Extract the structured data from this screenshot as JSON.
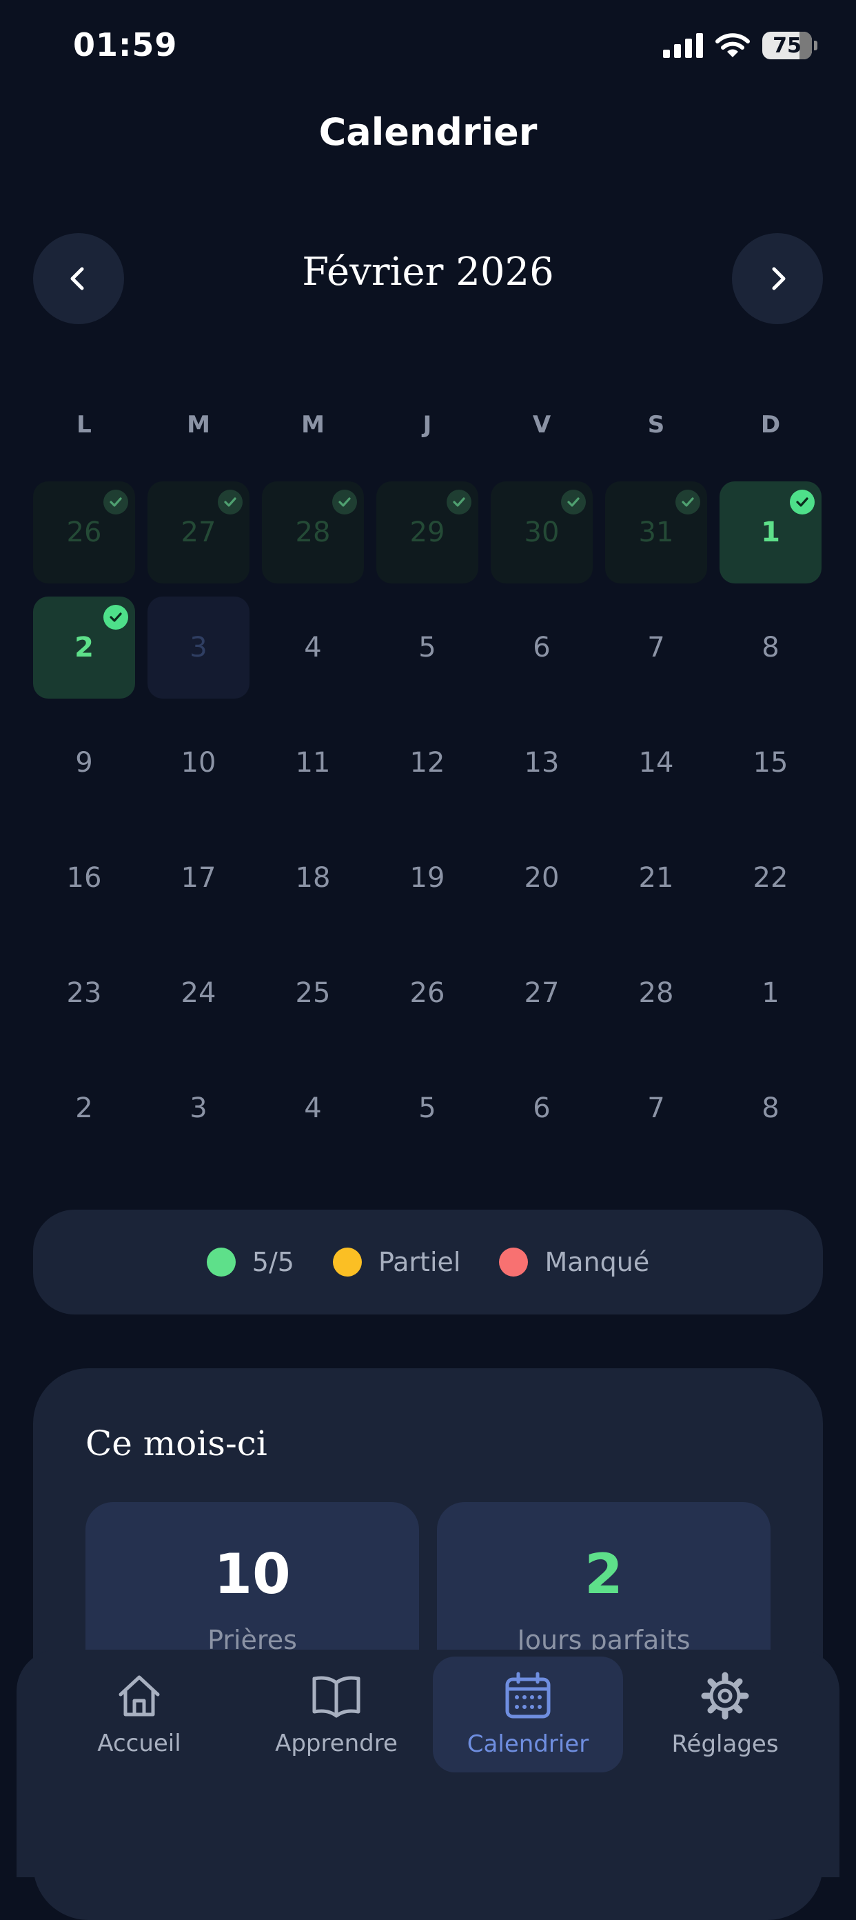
{
  "status_bar": {
    "time": "01:59",
    "battery": "75"
  },
  "header": {
    "title": "Calendrier"
  },
  "month_nav": {
    "title": "Février 2026",
    "prev_icon": "chevron-left-icon",
    "next_icon": "chevron-right-icon"
  },
  "weekdays": [
    "L",
    "M",
    "M",
    "J",
    "V",
    "S",
    "D"
  ],
  "weeks": [
    [
      {
        "label": "26",
        "state": "past",
        "check": true
      },
      {
        "label": "27",
        "state": "past",
        "check": true
      },
      {
        "label": "28",
        "state": "past",
        "check": true
      },
      {
        "label": "29",
        "state": "past",
        "check": true
      },
      {
        "label": "30",
        "state": "past",
        "check": true
      },
      {
        "label": "31",
        "state": "past",
        "check": true
      },
      {
        "label": "1",
        "state": "done",
        "check": true
      }
    ],
    [
      {
        "label": "2",
        "state": "done",
        "check": true
      },
      {
        "label": "3",
        "state": "today",
        "check": false
      },
      {
        "label": "4",
        "state": "future",
        "check": false
      },
      {
        "label": "5",
        "state": "future",
        "check": false
      },
      {
        "label": "6",
        "state": "future",
        "check": false
      },
      {
        "label": "7",
        "state": "future",
        "check": false
      },
      {
        "label": "8",
        "state": "future",
        "check": false
      }
    ],
    [
      {
        "label": "9",
        "state": "future",
        "check": false
      },
      {
        "label": "10",
        "state": "future",
        "check": false
      },
      {
        "label": "11",
        "state": "future",
        "check": false
      },
      {
        "label": "12",
        "state": "future",
        "check": false
      },
      {
        "label": "13",
        "state": "future",
        "check": false
      },
      {
        "label": "14",
        "state": "future",
        "check": false
      },
      {
        "label": "15",
        "state": "future",
        "check": false
      }
    ],
    [
      {
        "label": "16",
        "state": "future",
        "check": false
      },
      {
        "label": "17",
        "state": "future",
        "check": false
      },
      {
        "label": "18",
        "state": "future",
        "check": false
      },
      {
        "label": "19",
        "state": "future",
        "check": false
      },
      {
        "label": "20",
        "state": "future",
        "check": false
      },
      {
        "label": "21",
        "state": "future",
        "check": false
      },
      {
        "label": "22",
        "state": "future",
        "check": false
      }
    ],
    [
      {
        "label": "23",
        "state": "future",
        "check": false
      },
      {
        "label": "24",
        "state": "future",
        "check": false
      },
      {
        "label": "25",
        "state": "future",
        "check": false
      },
      {
        "label": "26",
        "state": "future",
        "check": false
      },
      {
        "label": "27",
        "state": "future",
        "check": false
      },
      {
        "label": "28",
        "state": "future",
        "check": false
      },
      {
        "label": "1",
        "state": "future",
        "check": false
      }
    ],
    [
      {
        "label": "2",
        "state": "future",
        "check": false
      },
      {
        "label": "3",
        "state": "future",
        "check": false
      },
      {
        "label": "4",
        "state": "future",
        "check": false
      },
      {
        "label": "5",
        "state": "future",
        "check": false
      },
      {
        "label": "6",
        "state": "future",
        "check": false
      },
      {
        "label": "7",
        "state": "future",
        "check": false
      },
      {
        "label": "8",
        "state": "future",
        "check": false
      }
    ]
  ],
  "legend": [
    {
      "label": "5/5",
      "color": "#5ee08a"
    },
    {
      "label": "Partiel",
      "color": "#fbbf24"
    },
    {
      "label": "Manqué",
      "color": "#f87171"
    }
  ],
  "month_summary": {
    "title": "Ce mois-ci",
    "stats": [
      {
        "value": "10",
        "label": "Prières",
        "color": "#ffffff"
      },
      {
        "value": "2",
        "label": "Jours parfaits",
        "color": "#5ee08a"
      }
    ]
  },
  "tabs": [
    {
      "label": "Accueil",
      "icon": "home-icon",
      "active": false
    },
    {
      "label": "Apprendre",
      "icon": "book-icon",
      "active": false
    },
    {
      "label": "Calendrier",
      "icon": "calendar-icon",
      "active": true
    },
    {
      "label": "Réglages",
      "icon": "gear-icon",
      "active": false
    }
  ],
  "colors": {
    "background": "#0b1120",
    "surface": "#1b2438",
    "accent": "#6f8ee0",
    "success": "#5ee08a"
  }
}
